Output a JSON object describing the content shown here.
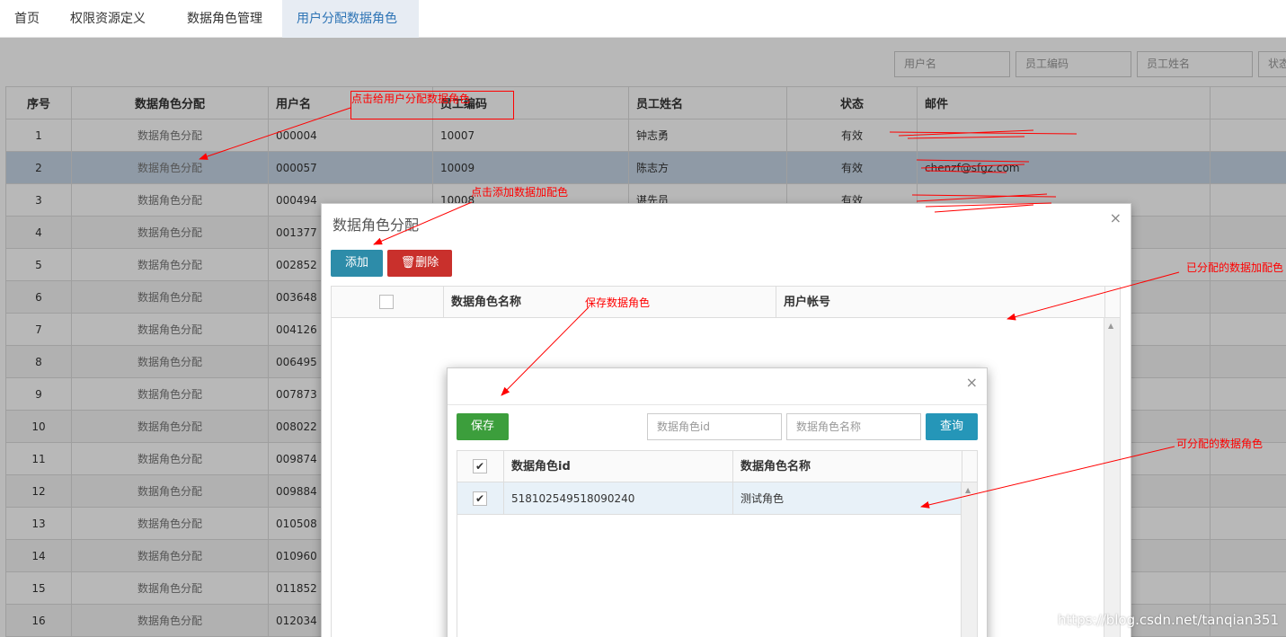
{
  "tabs": [
    {
      "label": "首页"
    },
    {
      "label": "权限资源定义"
    },
    {
      "label": "数据角色管理"
    },
    {
      "label": "用户分配数据角色",
      "active": true
    }
  ],
  "filters": {
    "username_ph": "用户名",
    "emp_code_ph": "员工编码",
    "emp_name_ph": "员工姓名",
    "status_ph": "状态"
  },
  "main_table": {
    "headers": [
      "序号",
      "数据角色分配",
      "用户名",
      "员工编码",
      "员工姓名",
      "状态",
      "邮件"
    ],
    "rows": [
      {
        "no": "1",
        "action": "数据角色分配",
        "user": "000004",
        "code": "10007",
        "name": "钟志勇",
        "status": "有效",
        "email": ""
      },
      {
        "no": "2",
        "action": "数据角色分配",
        "user": "000057",
        "code": "10009",
        "name": "陈志方",
        "status": "有效",
        "email": "chenzf@sfgz.com"
      },
      {
        "no": "3",
        "action": "数据角色分配",
        "user": "000494",
        "code": "10008",
        "name": "谌先员",
        "status": "有效",
        "email": ""
      },
      {
        "no": "4",
        "action": "数据角色分配",
        "user": "001377",
        "code": "",
        "name": "",
        "status": "",
        "email": ""
      },
      {
        "no": "5",
        "action": "数据角色分配",
        "user": "002852",
        "code": "",
        "name": "",
        "status": "",
        "email": ""
      },
      {
        "no": "6",
        "action": "数据角色分配",
        "user": "003648",
        "code": "",
        "name": "",
        "status": "",
        "email": ""
      },
      {
        "no": "7",
        "action": "数据角色分配",
        "user": "004126",
        "code": "",
        "name": "",
        "status": "",
        "email": ""
      },
      {
        "no": "8",
        "action": "数据角色分配",
        "user": "006495",
        "code": "",
        "name": "",
        "status": "",
        "email": ""
      },
      {
        "no": "9",
        "action": "数据角色分配",
        "user": "007873",
        "code": "",
        "name": "",
        "status": "",
        "email": ""
      },
      {
        "no": "10",
        "action": "数据角色分配",
        "user": "008022",
        "code": "",
        "name": "",
        "status": "",
        "email": ""
      },
      {
        "no": "11",
        "action": "数据角色分配",
        "user": "009874",
        "code": "",
        "name": "",
        "status": "",
        "email": ""
      },
      {
        "no": "12",
        "action": "数据角色分配",
        "user": "009884",
        "code": "",
        "name": "",
        "status": "",
        "email": ""
      },
      {
        "no": "13",
        "action": "数据角色分配",
        "user": "010508",
        "code": "",
        "name": "",
        "status": "",
        "email": ""
      },
      {
        "no": "14",
        "action": "数据角色分配",
        "user": "010960",
        "code": "",
        "name": "",
        "status": "",
        "email": ""
      },
      {
        "no": "15",
        "action": "数据角色分配",
        "user": "011852",
        "code": "",
        "name": "",
        "status": "",
        "email": ""
      },
      {
        "no": "16",
        "action": "数据角色分配",
        "user": "012034",
        "code": "",
        "name": "",
        "status": "",
        "email": ""
      }
    ]
  },
  "dialog1": {
    "title": "数据角色分配",
    "close": "×",
    "add_label": "添加",
    "delete_label": "🗑删除",
    "headers": [
      "数据角色名称",
      "用户帐号"
    ]
  },
  "dialog2": {
    "close": "×",
    "save_label": "保存",
    "query_label": "查询",
    "role_id_ph": "数据角色id",
    "role_name_ph": "数据角色名称",
    "headers": [
      "数据角色id",
      "数据角色名称"
    ],
    "rows": [
      {
        "id": "518102549518090240",
        "name": "测试角色",
        "checked": true
      }
    ]
  },
  "annotations": {
    "a1": "点击给用户分配数据角色",
    "a2": "点击添加数据加配色",
    "a3": "已分配的数据加配色",
    "a4": "保存数据角色",
    "a5": "可分配的数据角色"
  },
  "watermark": "https://blog.csdn.net/tanqian351",
  "colors": {
    "annotation": "#ff0000",
    "save": "#3c9e3c",
    "query": "#2596b8",
    "add": "#2d8ca9",
    "delete": "#c9302c",
    "active_tab": "#e7ecf3"
  }
}
